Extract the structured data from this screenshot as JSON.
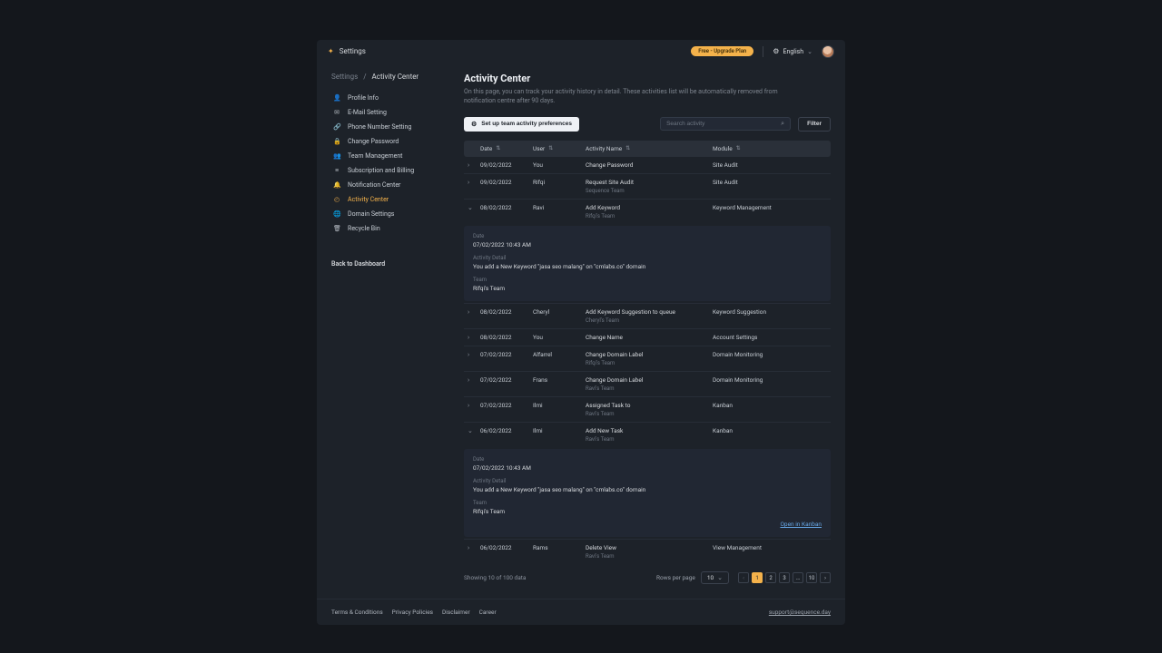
{
  "header": {
    "brand": "Settings",
    "plan_badge": "Free - Upgrade Plan",
    "language": "English"
  },
  "breadcrumb": {
    "root": "Settings",
    "sep": "/",
    "current": "Activity Center"
  },
  "sidebar": {
    "items": [
      {
        "icon": "👤",
        "label": "Profile Info"
      },
      {
        "icon": "✉",
        "label": "E-Mail Setting"
      },
      {
        "icon": "🔗",
        "label": "Phone Number Setting"
      },
      {
        "icon": "🔒",
        "label": "Change Password"
      },
      {
        "icon": "👥",
        "label": "Team Management"
      },
      {
        "icon": "≡",
        "label": "Subscription and Billing"
      },
      {
        "icon": "🔔",
        "label": "Notification Center"
      },
      {
        "icon": "◴",
        "label": "Activity Center",
        "active": true
      },
      {
        "icon": "🌐",
        "label": "Domain Settings"
      },
      {
        "icon": "🗑",
        "label": "Recycle Bin"
      }
    ],
    "back": "Back to Dashboard"
  },
  "page": {
    "title": "Activity Center",
    "desc": "On this page, you can track your activity history in detail. These activities list will be automatically removed from notification centre after 90 days."
  },
  "toolbar": {
    "prefs_btn": "Set up team activity preferences",
    "search_placeholder": "Search activity",
    "filter_btn": "Filter"
  },
  "table": {
    "headers": {
      "date": "Date",
      "user": "User",
      "activity": "Activity Name",
      "module": "Module"
    },
    "rows": [
      {
        "date": "09/02/2022",
        "user": "You",
        "activity": "Change Password",
        "sub": "",
        "module": "Site Audit"
      },
      {
        "date": "09/02/2022",
        "user": "Rifqi",
        "activity": "Request Site Audit",
        "sub": "Sequence Team",
        "module": "Site Audit"
      },
      {
        "date": "08/02/2022",
        "user": "Ravi",
        "activity": "Add Keyword",
        "sub": "Rifqi's Team",
        "module": "Keyword Management",
        "expanded": true,
        "detail": {
          "date": "07/02/2022 10:43 AM",
          "detail": "You add a New Keyword \"jasa seo malang\" on \"cmlabs.co\" domain",
          "team": "Rifqi's Team"
        }
      },
      {
        "date": "08/02/2022",
        "user": "Cheryl",
        "activity": "Add Keyword Suggestion to queue",
        "sub": "Cheryl's Team",
        "module": "Keyword Suggestion"
      },
      {
        "date": "08/02/2022",
        "user": "You",
        "activity": "Change Name",
        "sub": "",
        "module": "Account Settings"
      },
      {
        "date": "07/02/2022",
        "user": "Alfarrel",
        "activity": "Change Domain Label",
        "sub": "Rifqi's Team",
        "module": "Domain Monitoring"
      },
      {
        "date": "07/02/2022",
        "user": "Frans",
        "activity": "Change Domain Label",
        "sub": "Ravi's Team",
        "module": "Domain Monitoring"
      },
      {
        "date": "07/02/2022",
        "user": "Ilmi",
        "activity": "Assigned Task to",
        "sub": "Ravi's Team",
        "module": "Kanban"
      },
      {
        "date": "06/02/2022",
        "user": "Ilmi",
        "activity": "Add New Task",
        "sub": "Ravi's Team",
        "module": "Kanban",
        "expanded": true,
        "detail": {
          "date": "07/02/2022 10:43 AM",
          "detail": "You add a New Keyword \"jasa seo malang\" on \"cmlabs.co\" domain",
          "team": "Rifqi's Team",
          "link": "Open in Kanban"
        }
      },
      {
        "date": "06/02/2022",
        "user": "Rams",
        "activity": "Delete View",
        "sub": "Ravi's Team",
        "module": "View Management"
      }
    ]
  },
  "detail_labels": {
    "date": "Date",
    "detail": "Activity Detail",
    "team": "Team"
  },
  "pagination": {
    "showing": "Showing 10 of 100 data",
    "rpp_label": "Rows per page",
    "rpp_value": "10",
    "pages": [
      "1",
      "2",
      "3",
      "…",
      "10"
    ]
  },
  "footer": {
    "links": [
      "Terms & Conditions",
      "Privacy Policies",
      "Disclaimer",
      "Career"
    ],
    "support": "support@sequence.day"
  }
}
